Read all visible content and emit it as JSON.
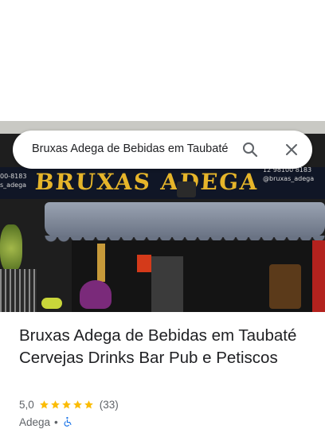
{
  "search": {
    "query": "Bruxas Adega de Bebidas em Taubaté",
    "icon": "search-icon",
    "clear_icon": "close-icon"
  },
  "photo": {
    "sign_text": "BRUXAS ADEGA",
    "sign_left_line1": "00-8183",
    "sign_left_line2": "s_adega",
    "sign_right_line1": "12 98100 8183",
    "sign_right_line2": "@bruxas_adega"
  },
  "place": {
    "title": "Bruxas Adega de Bebidas em Taubaté Cervejas Drinks Bar Pub e Petiscos",
    "rating": "5,0",
    "stars": 5,
    "review_count": "(33)",
    "category": "Adega",
    "separator": "•",
    "accessibility_icon": "wheelchair-icon"
  },
  "colors": {
    "star": "#fbbc04",
    "accessibility": "#1a73e8",
    "text_primary": "#202124",
    "text_secondary": "#5f6368"
  }
}
